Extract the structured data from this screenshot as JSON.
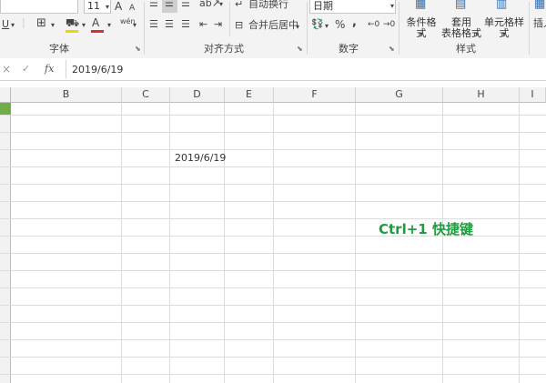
{
  "ribbon": {
    "font_size": "11",
    "grow_font": "A",
    "shrink_font": "A",
    "underline": "U",
    "border_arrow": "▾",
    "fill_arrow": "▾",
    "font_color_letter": "A",
    "phonetic": "wén",
    "wrap_text": "自动换行",
    "merge_center": "合并后居中",
    "number_format": "日期",
    "percent": "%",
    "comma": ",",
    "cond_format": "条件格式",
    "table_format_1": "套用",
    "table_format_2": "表格格式",
    "cell_styles": "单元格样式",
    "insert": "插入",
    "groups": {
      "font": "字体",
      "alignment": "对齐方式",
      "number": "数字",
      "styles": "样式"
    },
    "colors": {
      "fill": "#f5d100",
      "font_color": "#d9302c",
      "active": "#cfcfcf"
    }
  },
  "formula_bar": {
    "cancel": "×",
    "enter": "✓",
    "fx": "fx",
    "content": "2019/6/19"
  },
  "sheet": {
    "columns": [
      "B",
      "C",
      "D",
      "E",
      "F",
      "G",
      "H",
      "I"
    ],
    "selected_row_color": "#70ad47",
    "cell_d4": "2019/6/19",
    "annotation": "Ctrl+1 快捷键"
  }
}
